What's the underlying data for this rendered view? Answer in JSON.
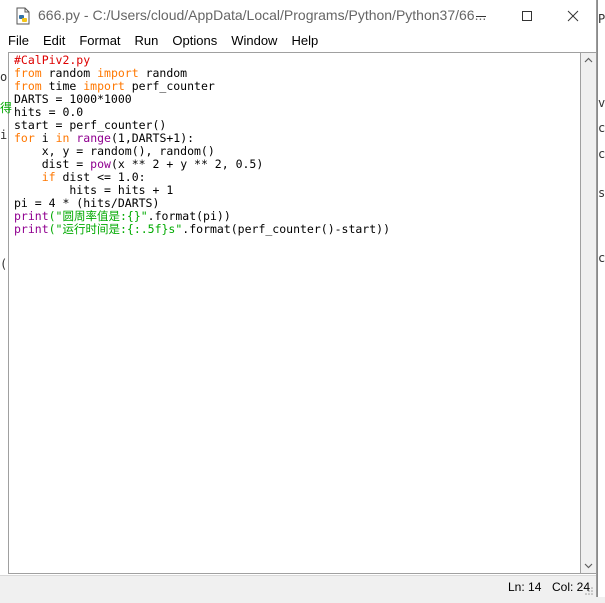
{
  "window": {
    "title": "666.py - C:/Users/cloud/AppData/Local/Programs/Python/Python37/66...",
    "app_icon": "python-idle-file-icon",
    "controls": {
      "minimize_icon": "minimize-icon",
      "maximize_icon": "maximize-icon",
      "close_icon": "close-icon"
    }
  },
  "menu": [
    "File",
    "Edit",
    "Format",
    "Run",
    "Options",
    "Window",
    "Help"
  ],
  "code_lines": [
    [
      {
        "t": "#CalPiv2.py",
        "c": "cm"
      }
    ],
    [
      {
        "t": "from",
        "c": "kw"
      },
      {
        "t": " random "
      },
      {
        "t": "import",
        "c": "kw"
      },
      {
        "t": " random"
      }
    ],
    [
      {
        "t": "from",
        "c": "kw"
      },
      {
        "t": " time "
      },
      {
        "t": "import",
        "c": "kw"
      },
      {
        "t": " perf_counter"
      }
    ],
    [
      {
        "t": "DARTS = 1000*1000"
      }
    ],
    [
      {
        "t": "hits = 0.0"
      }
    ],
    [
      {
        "t": "start = perf_counter()"
      }
    ],
    [
      {
        "t": "for",
        "c": "kw"
      },
      {
        "t": " i "
      },
      {
        "t": "in",
        "c": "kw"
      },
      {
        "t": " "
      },
      {
        "t": "range",
        "c": "bi"
      },
      {
        "t": "(1,DARTS+1):"
      }
    ],
    [
      {
        "t": "    x, y = random(), random()"
      }
    ],
    [
      {
        "t": "    dist = "
      },
      {
        "t": "pow",
        "c": "bi"
      },
      {
        "t": "(x ** 2 + y ** 2, 0.5)"
      }
    ],
    [
      {
        "t": "    "
      },
      {
        "t": "if",
        "c": "kw"
      },
      {
        "t": " dist <= 1.0:"
      }
    ],
    [
      {
        "t": "        hits = hits + 1"
      }
    ],
    [
      {
        "t": "pi = 4 * (hits/DARTS)"
      }
    ],
    [
      {
        "t": "print",
        "c": "bi"
      },
      {
        "t": "(\"圆周率值是:{}\"",
        "c": "st"
      },
      {
        "t": ".format(pi))"
      }
    ],
    [
      {
        "t": "print",
        "c": "bi"
      },
      {
        "t": "(\"运行时间是:{:.5f}s\"",
        "c": "st"
      },
      {
        "t": ".format(perf_counter()-start))"
      }
    ]
  ],
  "colors": {
    "keyword": "#ff7700",
    "builtin": "#900090",
    "string": "#00aa00",
    "comment": "#dd0000"
  },
  "status": {
    "line": "Ln: 14",
    "column": "Col: 24"
  },
  "background_fragments": {
    "right": [
      "P",
      "v",
      "c",
      "ch",
      "s/",
      "ch"
    ],
    "left": [
      "o",
      "得",
      "i",
      "("
    ]
  }
}
